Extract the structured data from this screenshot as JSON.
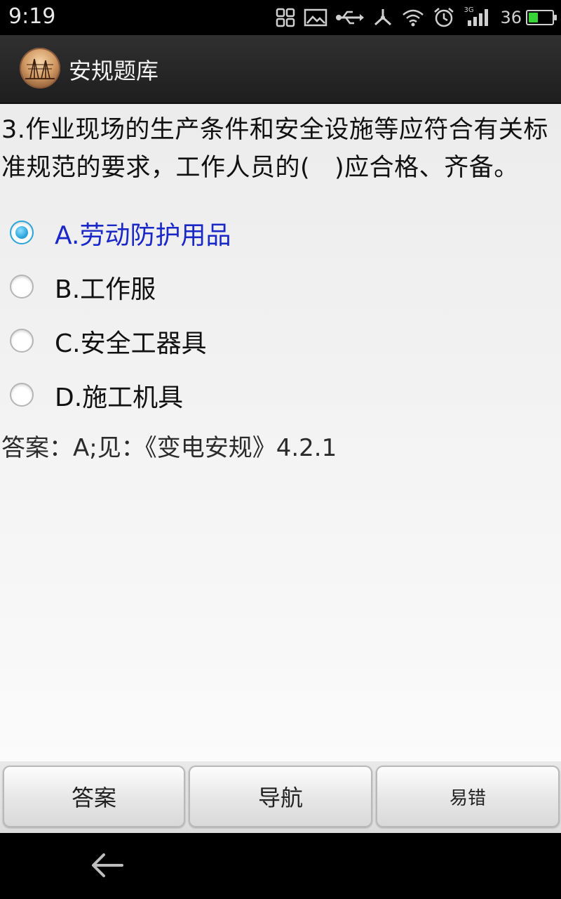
{
  "status_bar": {
    "time": "9:19",
    "network_label": "3G",
    "battery_text": "36",
    "battery_level": 0.36,
    "battery_color": "#37d437"
  },
  "action_bar": {
    "title": "安规题库",
    "icon": "app-logo-icon"
  },
  "question": {
    "text": "3.作业现场的生产条件和安全设施等应符合有关标准规范的要求，工作人员的(   )应合格、齐备。",
    "options": [
      {
        "label": "A.劳动防护用品",
        "selected": true
      },
      {
        "label": "B.工作服",
        "selected": false
      },
      {
        "label": "C.安全工器具",
        "selected": false
      },
      {
        "label": "D.施工机具",
        "selected": false
      }
    ],
    "answer": "答案：A;见：《变电安规》4.2.1"
  },
  "buttons": {
    "answer": "答案",
    "navigate": "导航",
    "error_prone": "易错"
  },
  "colors": {
    "selected_text": "#1a28c8",
    "radio_accent": "#2aa5d8"
  }
}
